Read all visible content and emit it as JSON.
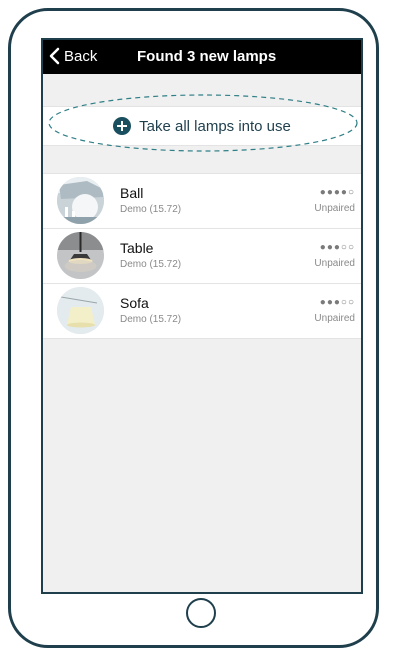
{
  "nav": {
    "back_label": "Back",
    "title": "Found 3 new lamps"
  },
  "action": {
    "take_all_label": "Take all lamps into use",
    "icon": "plus-circle-icon"
  },
  "lamps": [
    {
      "name": "Ball",
      "subtitle": "Demo (15.72)",
      "signal": "●●●●○",
      "status": "Unpaired",
      "thumbnail": "ball-lamp-image"
    },
    {
      "name": "Table",
      "subtitle": "Demo (15.72)",
      "signal": "●●●○○",
      "status": "Unpaired",
      "thumbnail": "table-lamp-image"
    },
    {
      "name": "Sofa",
      "subtitle": "Demo (15.72)",
      "signal": "●●●○○",
      "status": "Unpaired",
      "thumbnail": "sofa-lamp-image"
    }
  ],
  "colors": {
    "frame": "#1f3f4d",
    "nav_bar": "#000000",
    "accent": "#1a4f5f",
    "highlight_dashes": "#2f7f86"
  }
}
